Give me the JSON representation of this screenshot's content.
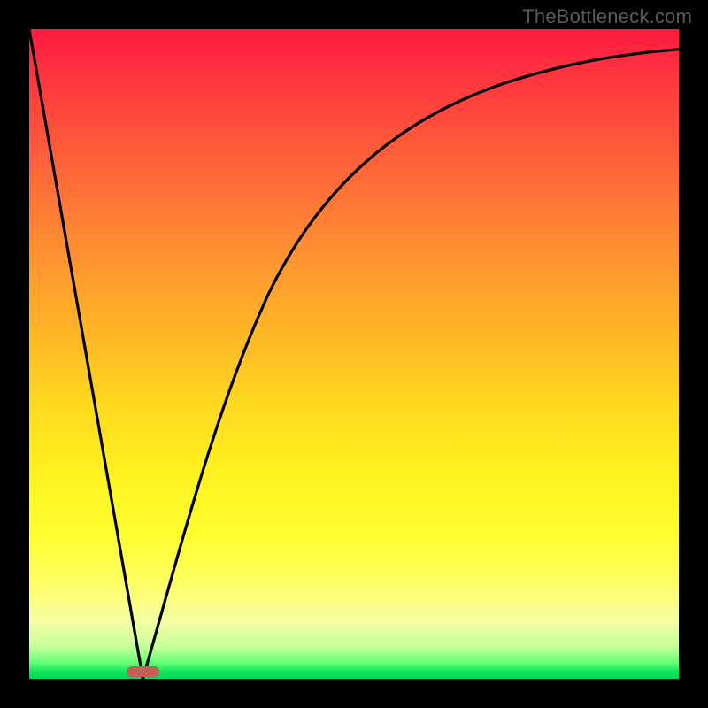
{
  "attribution": "TheBottleneck.com",
  "colors": {
    "frame": "#000000",
    "curve": "#000000",
    "marker": "#c06058"
  },
  "chart_data": {
    "type": "line",
    "title": "",
    "xlabel": "",
    "ylabel": "",
    "x_range": [
      0,
      100
    ],
    "y_range": [
      0,
      100
    ],
    "marker": {
      "x_center": 17.5,
      "y": 0.8,
      "width": 5,
      "height": 1.6
    },
    "series": [
      {
        "name": "left-branch",
        "x": [
          0.0,
          2.0,
          4.0,
          6.0,
          8.0,
          10.0,
          12.0,
          14.0,
          16.0,
          17.5
        ],
        "y": [
          100.0,
          88.6,
          77.1,
          65.7,
          54.3,
          42.9,
          31.4,
          20.0,
          8.6,
          0.0
        ]
      },
      {
        "name": "right-branch",
        "x": [
          17.5,
          20.0,
          24.0,
          28.0,
          32.0,
          36.0,
          40.0,
          45.0,
          50.0,
          55.0,
          60.0,
          65.0,
          70.0,
          75.0,
          80.0,
          85.0,
          90.0,
          95.0,
          100.0
        ],
        "y": [
          0.0,
          11.0,
          26.0,
          38.5,
          48.5,
          56.5,
          63.0,
          69.5,
          74.5,
          78.5,
          81.7,
          84.3,
          86.4,
          88.1,
          89.5,
          90.6,
          91.5,
          92.2,
          92.8
        ]
      }
    ],
    "background_gradient": {
      "top": "#ff1a3f",
      "mid": "#ffff30",
      "bottom": "#00d85a"
    }
  }
}
